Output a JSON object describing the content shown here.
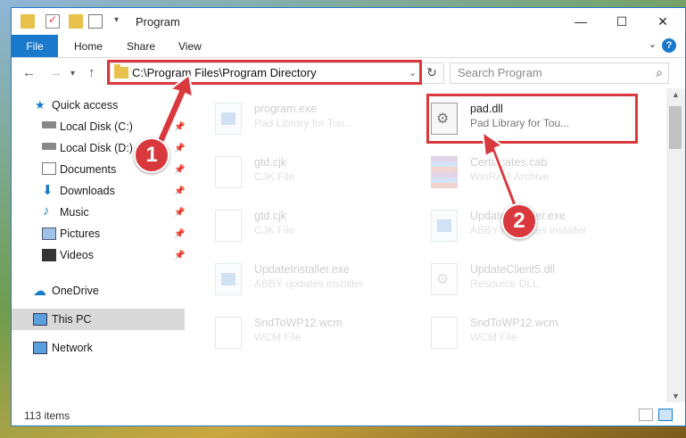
{
  "window": {
    "title": "Program",
    "controls": [
      "minimize-button",
      "maximize-button",
      "close-button"
    ]
  },
  "ribbon": {
    "file_tab": "File",
    "tabs": [
      "Home",
      "Share",
      "View"
    ],
    "help": "?"
  },
  "nav": {
    "address": "C:\\Program Files\\Program Directory",
    "search_placeholder": "Search Program"
  },
  "sidebar": {
    "items": [
      {
        "label": "Quick access",
        "icon": "star-icon",
        "pinned": false
      },
      {
        "label": "Local Disk (C:)",
        "icon": "drive-icon",
        "pinned": true
      },
      {
        "label": "Local Disk (D:)",
        "icon": "drive-icon",
        "pinned": true
      },
      {
        "label": "Documents",
        "icon": "documents-icon",
        "pinned": true
      },
      {
        "label": "Downloads",
        "icon": "download-icon",
        "pinned": true
      },
      {
        "label": "Music",
        "icon": "music-icon",
        "pinned": true
      },
      {
        "label": "Pictures",
        "icon": "pictures-icon",
        "pinned": true
      },
      {
        "label": "Videos",
        "icon": "videos-icon",
        "pinned": true
      },
      {
        "label": "OneDrive",
        "icon": "cloud-icon",
        "pinned": false
      },
      {
        "label": "This PC",
        "icon": "computer-icon",
        "pinned": false,
        "selected": true
      },
      {
        "label": "Network",
        "icon": "network-icon",
        "pinned": false
      }
    ]
  },
  "files": [
    {
      "name": "program.exe",
      "desc": "Pad Library for Tou...",
      "icon": "installer-icon",
      "highlighted": false
    },
    {
      "name": "pad.dll",
      "desc": "Pad Library for Tou...",
      "icon": "dll-icon",
      "highlighted": true
    },
    {
      "name": "gtd.cjk",
      "desc": "CJK File",
      "icon": "file-icon",
      "highlighted": false
    },
    {
      "name": "Certificates.cab",
      "desc": "WinRAR Archive",
      "icon": "archive-icon",
      "highlighted": false
    },
    {
      "name": "gtd.cjk",
      "desc": "CJK File",
      "icon": "file-icon",
      "highlighted": false
    },
    {
      "name": "UpdateInstaller.exe",
      "desc": "ABBYY updates installer",
      "icon": "exe-icon",
      "highlighted": false
    },
    {
      "name": "UpdateInstaller.exe",
      "desc": "ABBY updates installer",
      "icon": "exe-icon",
      "highlighted": false
    },
    {
      "name": "UpdateClient5.dll",
      "desc": "Resource DLL",
      "icon": "dll-icon",
      "highlighted": false
    },
    {
      "name": "SndToWP12.wcm",
      "desc": "WCM File",
      "icon": "file-icon",
      "highlighted": false
    },
    {
      "name": "SndToWP12.wcm",
      "desc": "WCM File",
      "icon": "file-icon",
      "highlighted": false
    }
  ],
  "status": {
    "items_count": "113 items"
  },
  "annotations": {
    "step1": "1",
    "step2": "2",
    "color": "#d9383d"
  }
}
